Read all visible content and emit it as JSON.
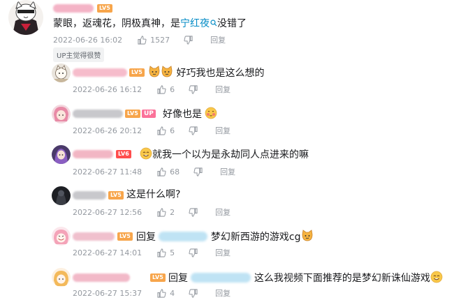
{
  "main_comment": {
    "level": "LV5",
    "text": "蒙眼，返魂花，阴极真神，是",
    "link_text": "宁红夜",
    "text_after": "没错了",
    "time": "2022-06-26 16:02",
    "likes": "1527",
    "reply_label": "回复",
    "up_liked_tag": "UP主觉得很赞"
  },
  "replies": [
    {
      "level": "LV5",
      "text": "好巧我也是这么想的",
      "time": "2022-06-26 16:12",
      "likes": "6",
      "reply_label": "回复"
    },
    {
      "level": "LV5",
      "up_badge": "UP",
      "text": "好像也是",
      "time": "2022-06-26 20:12",
      "likes": "6",
      "reply_label": "回复"
    },
    {
      "level": "LV6",
      "text": "就我一个以为是永劫同人点进来的嘛",
      "time": "2022-06-27 11:48",
      "likes": "68",
      "reply_label": "回复"
    },
    {
      "level": "LV5",
      "text": "这是什么啊?",
      "time": "2022-06-27 12:56",
      "likes": "2",
      "reply_label": "回复"
    },
    {
      "level": "LV5",
      "prefix": "回复",
      "text": "梦幻新西游的游戏cg",
      "time": "2022-06-27 14:01",
      "likes": "5",
      "reply_label": "回复"
    },
    {
      "level": "LV5",
      "prefix": "回复",
      "text": "这么我视频下面推荐的是梦幻新诛仙游戏",
      "time": "2022-06-27 15:37",
      "likes": "4",
      "reply_label": "回复"
    }
  ],
  "colors": {
    "accent_link": "#008ac5",
    "level_orange": "#f7a54b",
    "level_red": "#ff4d4d",
    "up_pink": "#fb7299",
    "meta_gray": "#9499a0"
  },
  "icons": [
    "thumb-up-icon",
    "thumb-down-icon",
    "search-link-icon",
    "cat-emoji",
    "blush-emoji",
    "smile-emoji"
  ]
}
